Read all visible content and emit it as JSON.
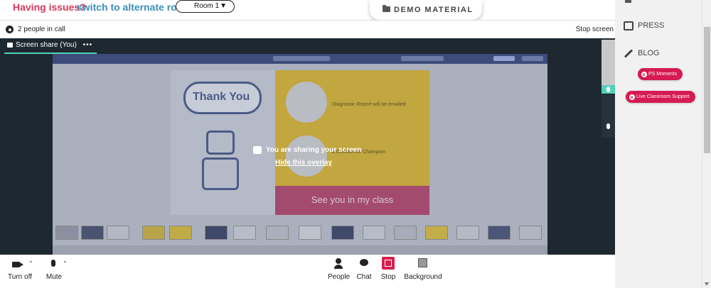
{
  "header": {
    "issues_text": "Having issues?",
    "switch_link": "switch to alternate room",
    "room_select": "Room 1",
    "demo_button": "DEMO MATERIAL"
  },
  "call": {
    "people_count": "2 people in call",
    "stop_screen": "Stop screen",
    "tab_label": "Screen share (You)",
    "tab_more": "•••",
    "overlay_message": "You are sharing your screen",
    "overlay_hide": "Hide this overlay",
    "slide": {
      "title": "Thank You",
      "diagnostic_text": "Diagnostic Report will be emailed",
      "champion_text": "a Confidence Champion",
      "see_you": "See you in my class"
    }
  },
  "controls": {
    "camera": "Turn off",
    "mic": "Mute",
    "people": "People",
    "chat": "Chat",
    "stop": "Stop",
    "background": "Background"
  },
  "sidebar": {
    "items": [
      {
        "label": "PRESS",
        "icon": "newspaper-icon"
      },
      {
        "label": "BLOG",
        "icon": "pencil-icon"
      }
    ],
    "pills": [
      "PS Moments",
      "Live Classroom Support"
    ]
  },
  "colors": {
    "accent_pink": "#d61a52",
    "link_blue": "#3a8fb7",
    "issues_red": "#d43b5a",
    "teal": "#4fd1b8",
    "stage_bg": "#1e2830"
  }
}
